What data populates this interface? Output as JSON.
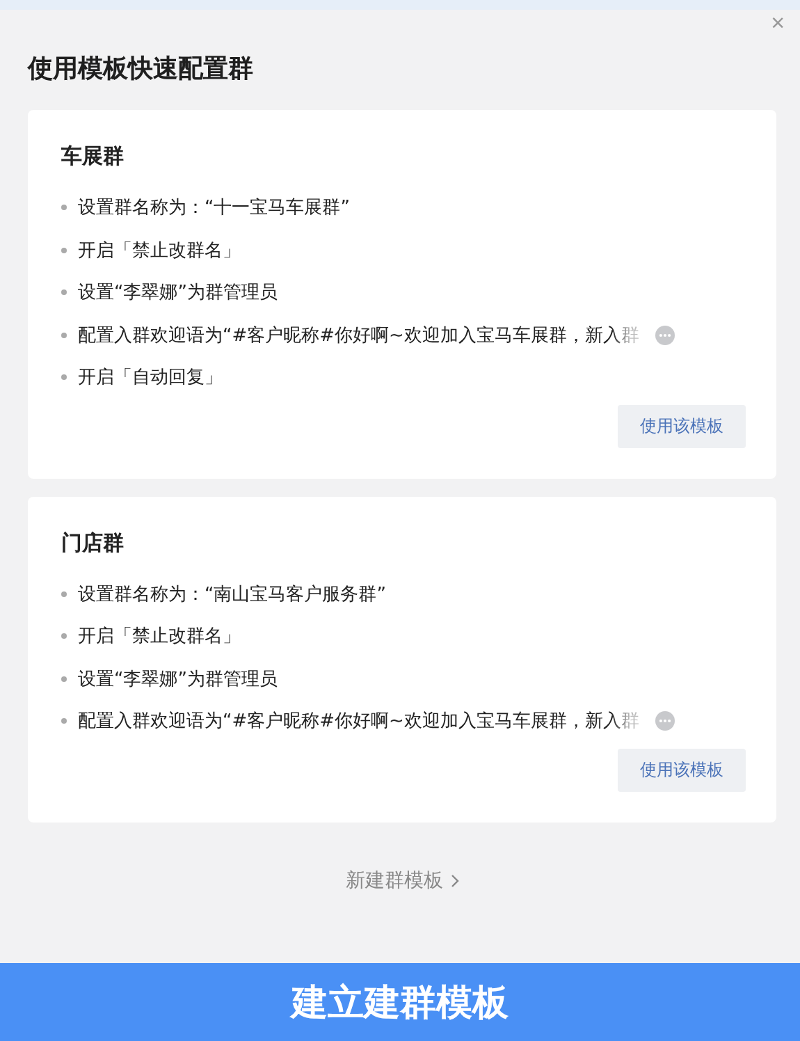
{
  "dialog": {
    "title": "使用模板快速配置群",
    "close": "×"
  },
  "templates": [
    {
      "name": "车展群",
      "items": [
        {
          "text": "设置群名称为：“十一宝马车展群”",
          "truncated": false
        },
        {
          "text": "开启「禁止改群名」",
          "truncated": false
        },
        {
          "text": "设置“李翠娜”为群管理员",
          "truncated": false
        },
        {
          "text": "配置入群欢迎语为“#客户昵称#你好啊~欢迎加入宝马车展群，新入群",
          "truncated": true
        },
        {
          "text": "开启「自动回复」",
          "truncated": false
        }
      ],
      "button": "使用该模板"
    },
    {
      "name": "门店群",
      "items": [
        {
          "text": "设置群名称为：“南山宝马客户服务群”",
          "truncated": false
        },
        {
          "text": "开启「禁止改群名」",
          "truncated": false
        },
        {
          "text": "设置“李翠娜”为群管理员",
          "truncated": false
        },
        {
          "text": "配置入群欢迎语为“#客户昵称#你好啊~欢迎加入宝马车展群，新入群",
          "truncated": true
        }
      ],
      "button": "使用该模板"
    }
  ],
  "new_template_link": "新建群模板",
  "primary_button": "建立建群模板"
}
